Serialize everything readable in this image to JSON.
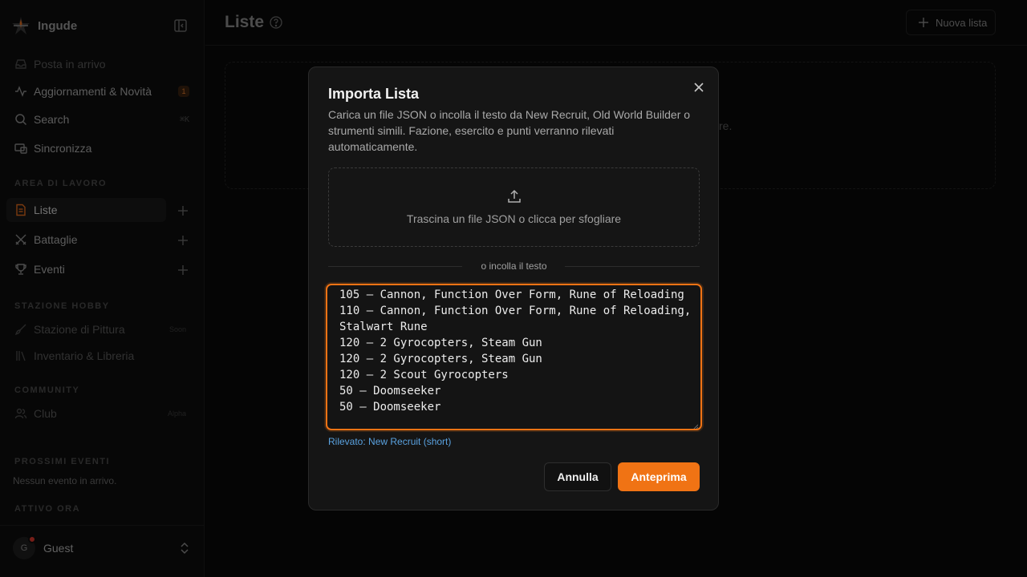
{
  "app": {
    "name": "Ingude"
  },
  "sidebar": {
    "items": [
      {
        "label": "Posta in arrivo",
        "icon": "inbox-icon"
      },
      {
        "label": "Aggiornamenti & Novità",
        "icon": "activity-icon",
        "badge": "1"
      },
      {
        "label": "Search",
        "icon": "search-icon",
        "shortcut": "⌘K"
      },
      {
        "label": "Sincronizza",
        "icon": "sync-icon"
      }
    ],
    "workspace": {
      "label": "AREA DI LAVORO",
      "items": [
        {
          "label": "Liste",
          "icon": "list-file-icon"
        },
        {
          "label": "Battaglie",
          "icon": "swords-icon"
        },
        {
          "label": "Eventi",
          "icon": "trophy-icon"
        }
      ]
    },
    "hobby": {
      "label": "STAZIONE HOBBY",
      "items": [
        {
          "label": "Stazione di Pittura",
          "icon": "brush-icon",
          "tag": "Soon"
        },
        {
          "label": "Inventario & Libreria",
          "icon": "library-icon"
        }
      ]
    },
    "community": {
      "label": "COMMUNITY",
      "items": [
        {
          "label": "Club",
          "icon": "users-icon",
          "tag": "Alpha"
        }
      ]
    },
    "upcoming": {
      "label": "PROSSIMI EVENTI",
      "empty": "Nessun evento in arrivo."
    },
    "active": {
      "label": "ATTIVO ORA"
    },
    "user": {
      "initial": "G",
      "name": "Guest"
    }
  },
  "header": {
    "title": "Liste",
    "new_list_label": "Nuova lista"
  },
  "background": {
    "card_text_tail": "re."
  },
  "modal": {
    "title": "Importa Lista",
    "description": "Carica un file JSON o incolla il testo da New Recruit, Old World Builder o strumenti simili. Fazione, esercito e punti verranno rilevati automaticamente.",
    "dropzone_text": "Trascina un file JSON o clicca per sfogliare",
    "divider_text": "o incolla il testo",
    "textarea_value": "105 – Cannon, Function Over Form, Rune of Reloading\n110 – Cannon, Function Over Form, Rune of Reloading, Stalwart Rune\n120 – 2 Gyrocopters, Steam Gun\n120 – 2 Gyrocopters, Steam Gun\n120 – 2 Scout Gyrocopters\n50 – Doomseeker\n50 – Doomseeker",
    "detected_text": "Rilevato: New Recruit (short)",
    "cancel_label": "Annulla",
    "preview_label": "Anteprima"
  },
  "colors": {
    "accent": "#f07314",
    "detected": "#5aa2e0",
    "badge": "#e07a2c"
  }
}
